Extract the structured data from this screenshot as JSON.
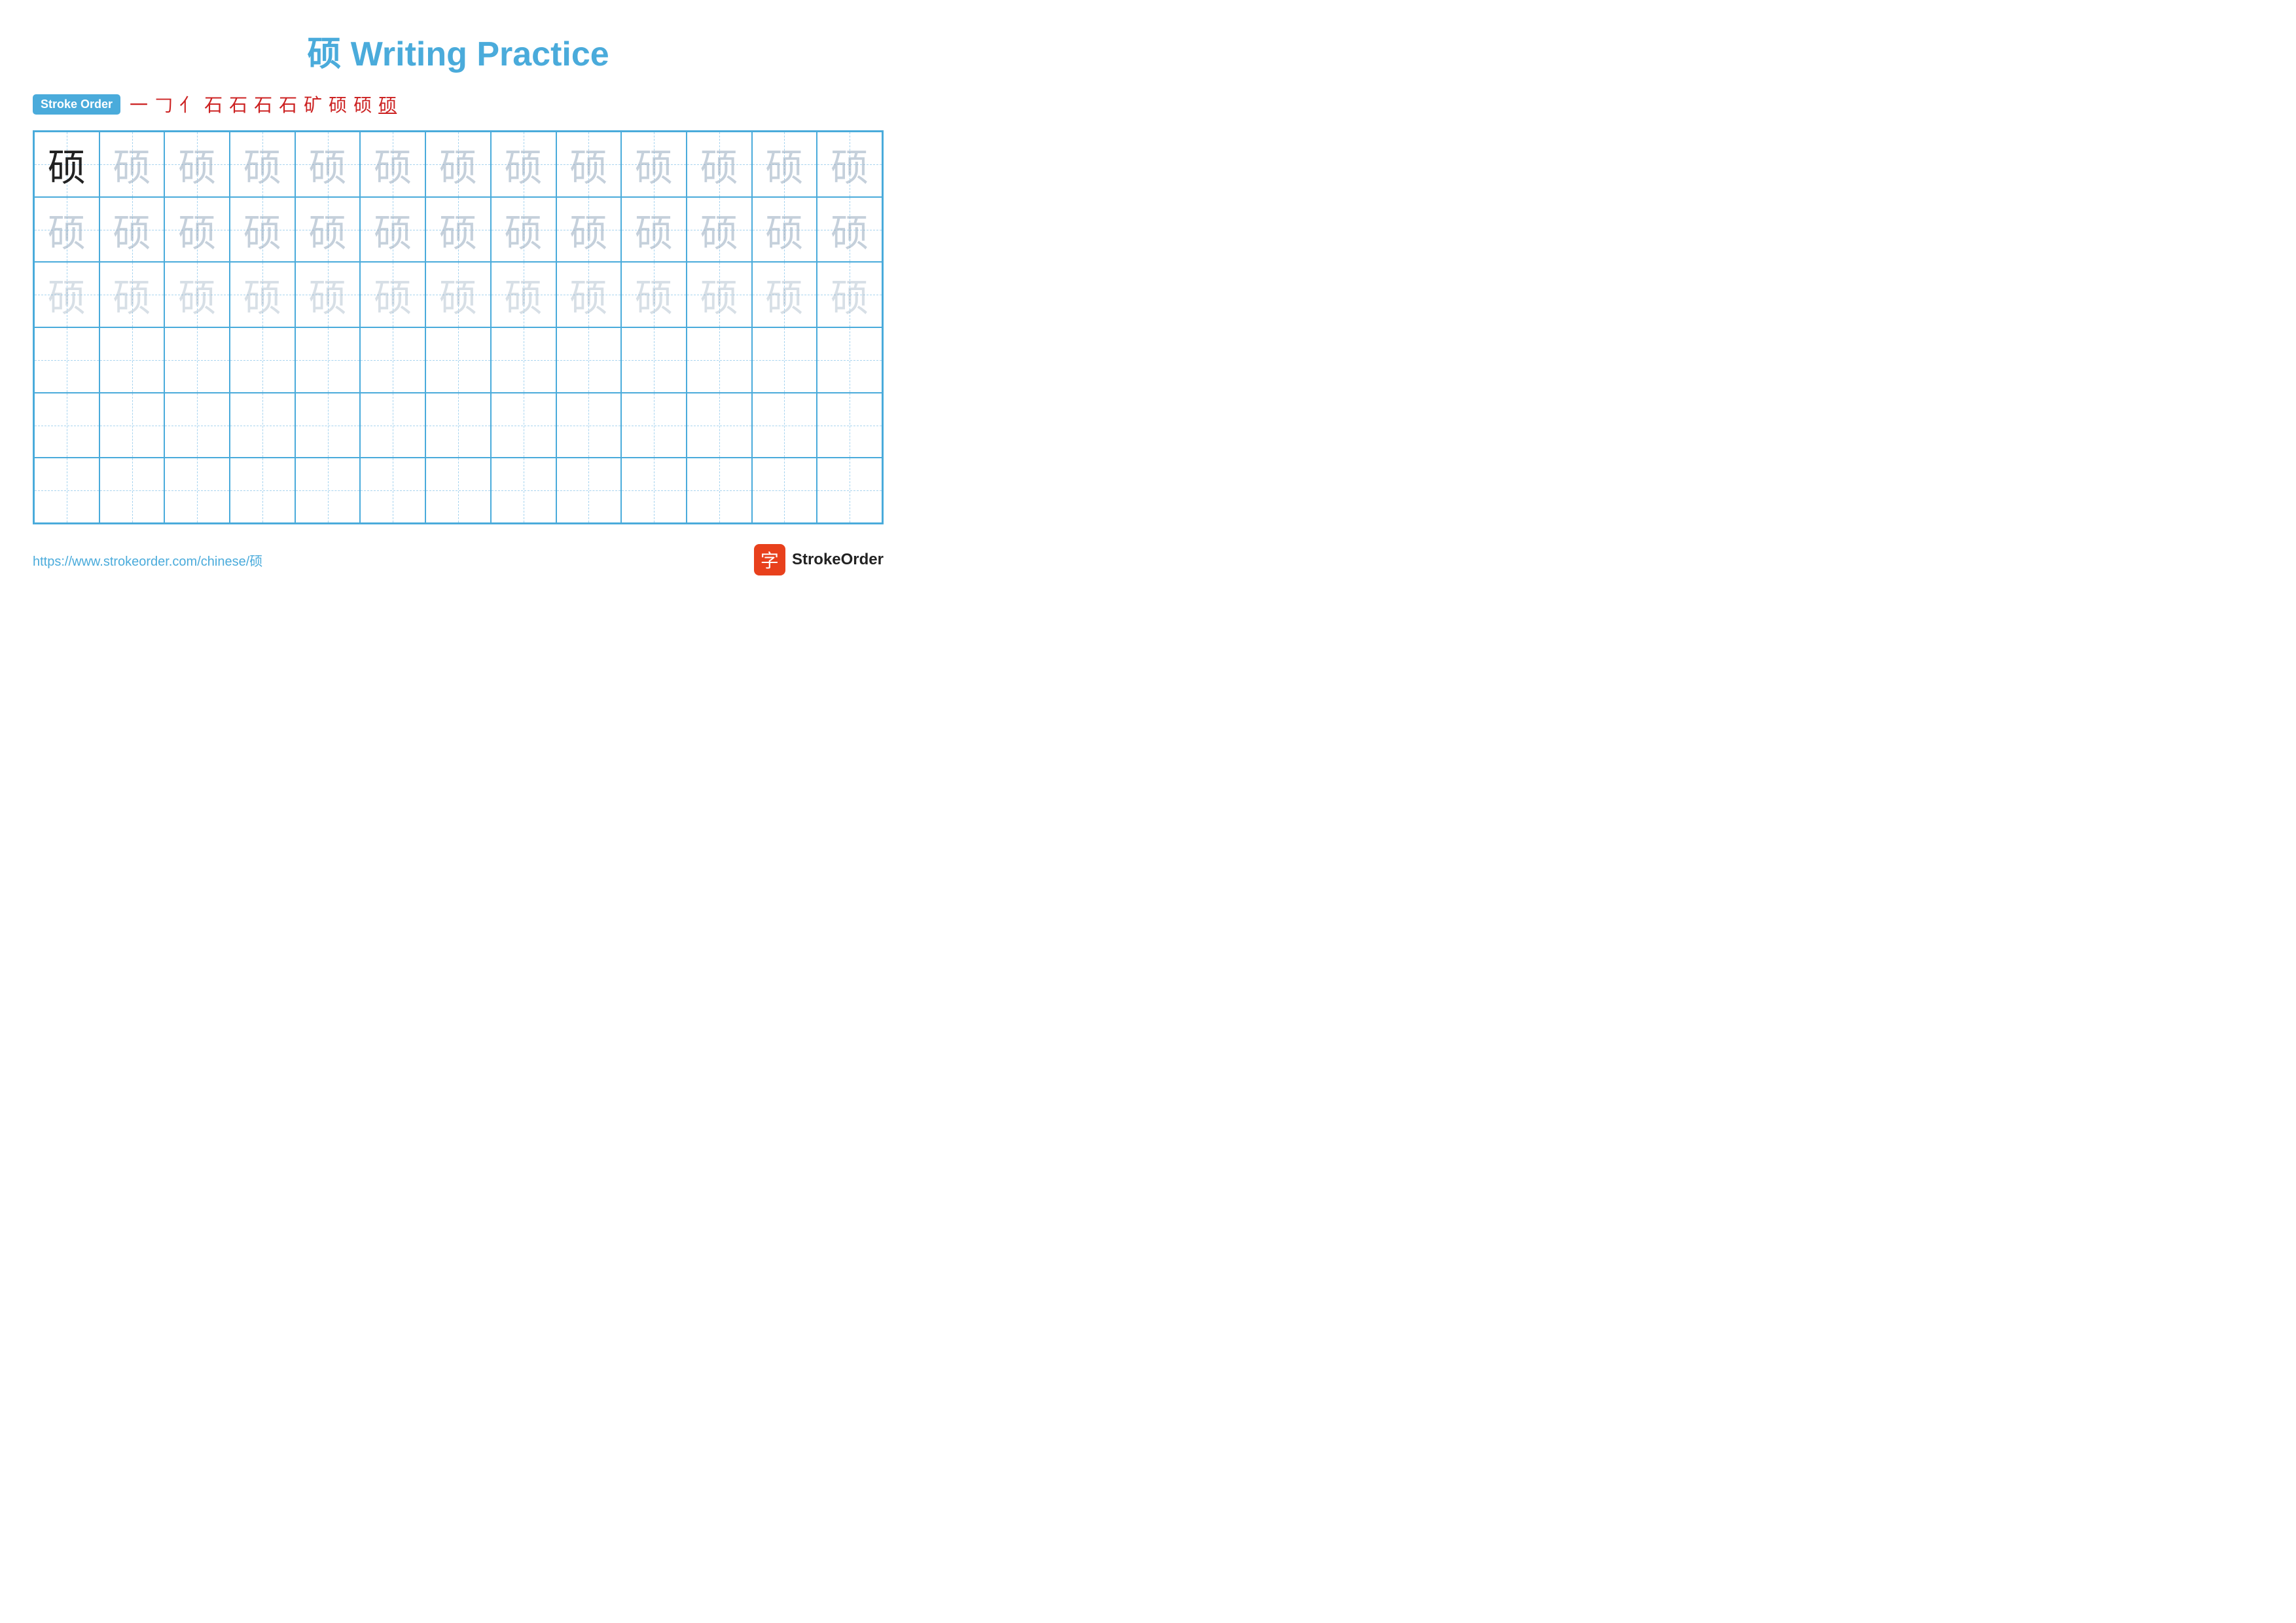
{
  "page": {
    "title": "硕 Writing Practice",
    "url": "https://www.strokeorder.com/chinese/硕",
    "logo_text": "StrokeOrder",
    "logo_icon": "字"
  },
  "stroke_order": {
    "badge_label": "Stroke Order",
    "strokes": [
      "一",
      "𠃌",
      "亻",
      "石",
      "石",
      "石",
      "石",
      "矿",
      "硕",
      "硕",
      "硕"
    ]
  },
  "grid": {
    "character": "硕",
    "rows": 6,
    "cols": 13,
    "row_types": [
      "solid_then_light1",
      "light1",
      "light2",
      "empty",
      "empty",
      "empty"
    ]
  },
  "colors": {
    "accent": "#4aabdb",
    "stroke_red": "#cc2222",
    "grid_border": "#4aabdb",
    "grid_guide": "#a8d4ef",
    "solid_char": "#222222",
    "light1_char": "rgba(150,170,190,0.55)",
    "light2_char": "rgba(150,170,190,0.38)"
  }
}
